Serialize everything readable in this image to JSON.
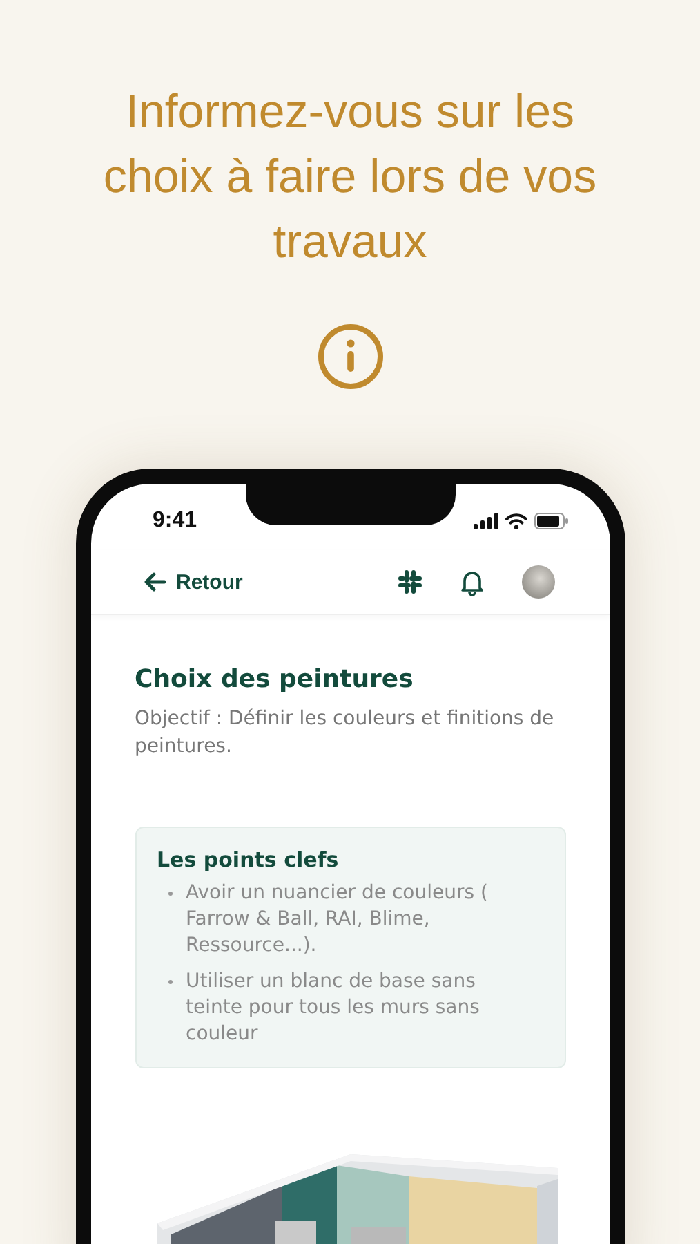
{
  "headline": "Informez-vous sur les choix à faire lors de vos travaux",
  "phone": {
    "status_time": "9:41",
    "nav": {
      "back_label": "Retour"
    },
    "content": {
      "title": "Choix des peintures",
      "objective": "Objectif : Définir les couleurs et finitions de peintures.",
      "key_points": {
        "title": "Les points clefs",
        "items": [
          "Avoir un nuancier de couleurs ( Farrow & Ball, RAI, Blime, Ressource...).",
          "Utiliser un blanc de base sans teinte pour tous les murs sans couleur"
        ]
      }
    }
  }
}
